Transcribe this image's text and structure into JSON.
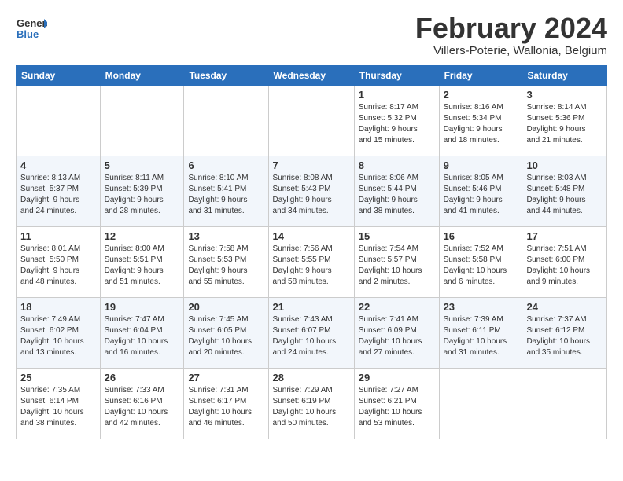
{
  "header": {
    "logo_general": "General",
    "logo_blue": "Blue",
    "month_title": "February 2024",
    "subtitle": "Villers-Poterie, Wallonia, Belgium"
  },
  "days_of_week": [
    "Sunday",
    "Monday",
    "Tuesday",
    "Wednesday",
    "Thursday",
    "Friday",
    "Saturday"
  ],
  "weeks": [
    [
      {
        "num": "",
        "info": ""
      },
      {
        "num": "",
        "info": ""
      },
      {
        "num": "",
        "info": ""
      },
      {
        "num": "",
        "info": ""
      },
      {
        "num": "1",
        "info": "Sunrise: 8:17 AM\nSunset: 5:32 PM\nDaylight: 9 hours\nand 15 minutes."
      },
      {
        "num": "2",
        "info": "Sunrise: 8:16 AM\nSunset: 5:34 PM\nDaylight: 9 hours\nand 18 minutes."
      },
      {
        "num": "3",
        "info": "Sunrise: 8:14 AM\nSunset: 5:36 PM\nDaylight: 9 hours\nand 21 minutes."
      }
    ],
    [
      {
        "num": "4",
        "info": "Sunrise: 8:13 AM\nSunset: 5:37 PM\nDaylight: 9 hours\nand 24 minutes."
      },
      {
        "num": "5",
        "info": "Sunrise: 8:11 AM\nSunset: 5:39 PM\nDaylight: 9 hours\nand 28 minutes."
      },
      {
        "num": "6",
        "info": "Sunrise: 8:10 AM\nSunset: 5:41 PM\nDaylight: 9 hours\nand 31 minutes."
      },
      {
        "num": "7",
        "info": "Sunrise: 8:08 AM\nSunset: 5:43 PM\nDaylight: 9 hours\nand 34 minutes."
      },
      {
        "num": "8",
        "info": "Sunrise: 8:06 AM\nSunset: 5:44 PM\nDaylight: 9 hours\nand 38 minutes."
      },
      {
        "num": "9",
        "info": "Sunrise: 8:05 AM\nSunset: 5:46 PM\nDaylight: 9 hours\nand 41 minutes."
      },
      {
        "num": "10",
        "info": "Sunrise: 8:03 AM\nSunset: 5:48 PM\nDaylight: 9 hours\nand 44 minutes."
      }
    ],
    [
      {
        "num": "11",
        "info": "Sunrise: 8:01 AM\nSunset: 5:50 PM\nDaylight: 9 hours\nand 48 minutes."
      },
      {
        "num": "12",
        "info": "Sunrise: 8:00 AM\nSunset: 5:51 PM\nDaylight: 9 hours\nand 51 minutes."
      },
      {
        "num": "13",
        "info": "Sunrise: 7:58 AM\nSunset: 5:53 PM\nDaylight: 9 hours\nand 55 minutes."
      },
      {
        "num": "14",
        "info": "Sunrise: 7:56 AM\nSunset: 5:55 PM\nDaylight: 9 hours\nand 58 minutes."
      },
      {
        "num": "15",
        "info": "Sunrise: 7:54 AM\nSunset: 5:57 PM\nDaylight: 10 hours\nand 2 minutes."
      },
      {
        "num": "16",
        "info": "Sunrise: 7:52 AM\nSunset: 5:58 PM\nDaylight: 10 hours\nand 6 minutes."
      },
      {
        "num": "17",
        "info": "Sunrise: 7:51 AM\nSunset: 6:00 PM\nDaylight: 10 hours\nand 9 minutes."
      }
    ],
    [
      {
        "num": "18",
        "info": "Sunrise: 7:49 AM\nSunset: 6:02 PM\nDaylight: 10 hours\nand 13 minutes."
      },
      {
        "num": "19",
        "info": "Sunrise: 7:47 AM\nSunset: 6:04 PM\nDaylight: 10 hours\nand 16 minutes."
      },
      {
        "num": "20",
        "info": "Sunrise: 7:45 AM\nSunset: 6:05 PM\nDaylight: 10 hours\nand 20 minutes."
      },
      {
        "num": "21",
        "info": "Sunrise: 7:43 AM\nSunset: 6:07 PM\nDaylight: 10 hours\nand 24 minutes."
      },
      {
        "num": "22",
        "info": "Sunrise: 7:41 AM\nSunset: 6:09 PM\nDaylight: 10 hours\nand 27 minutes."
      },
      {
        "num": "23",
        "info": "Sunrise: 7:39 AM\nSunset: 6:11 PM\nDaylight: 10 hours\nand 31 minutes."
      },
      {
        "num": "24",
        "info": "Sunrise: 7:37 AM\nSunset: 6:12 PM\nDaylight: 10 hours\nand 35 minutes."
      }
    ],
    [
      {
        "num": "25",
        "info": "Sunrise: 7:35 AM\nSunset: 6:14 PM\nDaylight: 10 hours\nand 38 minutes."
      },
      {
        "num": "26",
        "info": "Sunrise: 7:33 AM\nSunset: 6:16 PM\nDaylight: 10 hours\nand 42 minutes."
      },
      {
        "num": "27",
        "info": "Sunrise: 7:31 AM\nSunset: 6:17 PM\nDaylight: 10 hours\nand 46 minutes."
      },
      {
        "num": "28",
        "info": "Sunrise: 7:29 AM\nSunset: 6:19 PM\nDaylight: 10 hours\nand 50 minutes."
      },
      {
        "num": "29",
        "info": "Sunrise: 7:27 AM\nSunset: 6:21 PM\nDaylight: 10 hours\nand 53 minutes."
      },
      {
        "num": "",
        "info": ""
      },
      {
        "num": "",
        "info": ""
      }
    ]
  ]
}
